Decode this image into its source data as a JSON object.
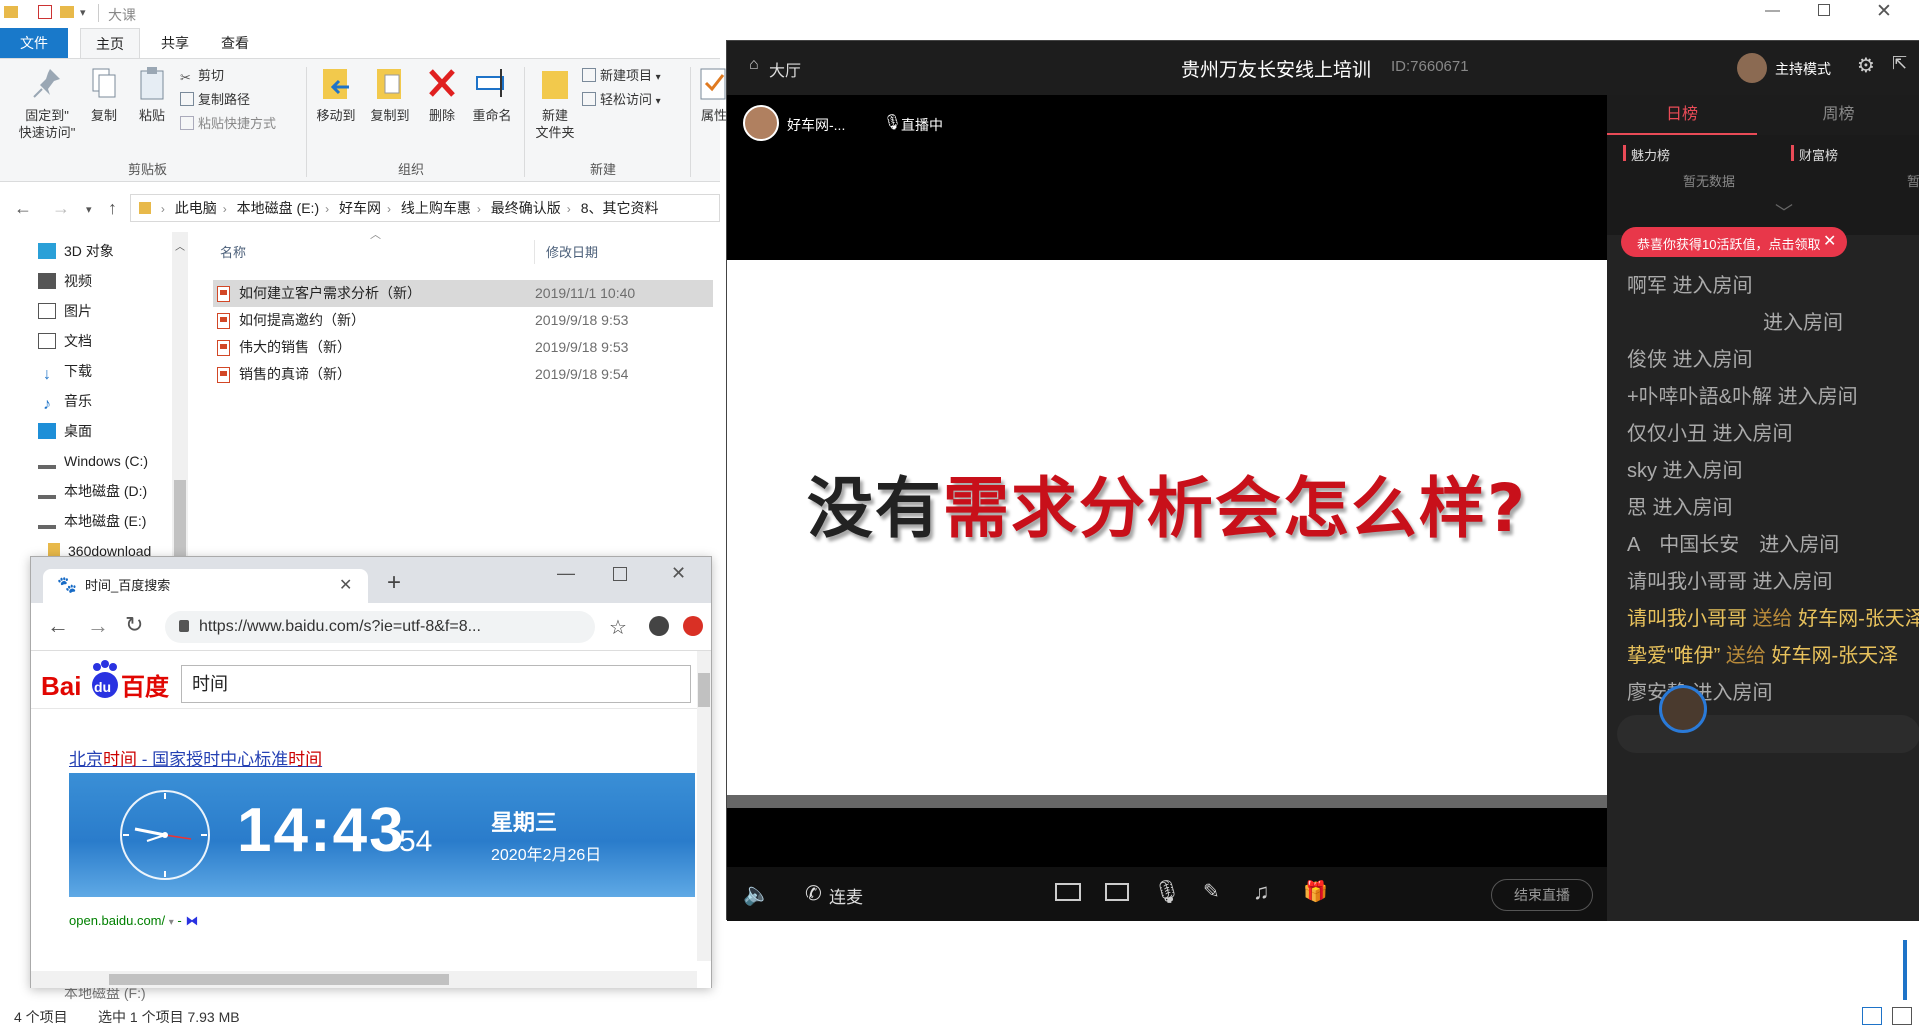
{
  "explorer": {
    "window_title": "大课",
    "tabs": {
      "file": "文件",
      "home": "主页",
      "share": "共享",
      "view": "查看"
    },
    "ribbon": {
      "pin": "固定到\"\n快速访问\"",
      "pin_l1": "固定到\"",
      "pin_l2": "快速访问\"",
      "copy": "复制",
      "paste": "粘贴",
      "cut": "剪切",
      "copy_path": "复制路径",
      "paste_shortcut": "粘贴快捷方式",
      "group_clipboard": "剪贴板",
      "move_to": "移动到",
      "copy_to": "复制到",
      "delete": "删除",
      "rename": "重命名",
      "group_organize": "组织",
      "new_folder_l1": "新建",
      "new_folder_l2": "文件夹",
      "new_item": "新建项目",
      "easy_access": "轻松访问",
      "group_new": "新建",
      "properties": "属性"
    },
    "breadcrumb": [
      "此电脑",
      "本地磁盘 (E:)",
      "好车网",
      "线上购车惠",
      "最终确认版",
      "8、其它资料"
    ],
    "nav": [
      {
        "label": "3D 对象",
        "icon": "3d-objects-icon",
        "color": "#2aa0d8"
      },
      {
        "label": "视频",
        "icon": "video-icon",
        "color": "#555"
      },
      {
        "label": "图片",
        "icon": "pictures-icon",
        "color": "#555"
      },
      {
        "label": "文档",
        "icon": "documents-icon",
        "color": "#555"
      },
      {
        "label": "下载",
        "icon": "download-icon",
        "color": "#1e73c8"
      },
      {
        "label": "音乐",
        "icon": "music-icon",
        "color": "#1e73c8"
      },
      {
        "label": "桌面",
        "icon": "desktop-icon",
        "color": "#1e8fd8"
      },
      {
        "label": "Windows (C:)",
        "icon": "drive-icon",
        "color": "#666"
      },
      {
        "label": "本地磁盘 (D:)",
        "icon": "drive-icon",
        "color": "#666"
      },
      {
        "label": "本地磁盘 (E:)",
        "icon": "drive-icon",
        "color": "#666"
      },
      {
        "label": "360download",
        "icon": "folder-icon",
        "color": "#e8b94a"
      }
    ],
    "nav_bottom": "本地磁盘 (F:)",
    "columns": {
      "name": "名称",
      "date": "修改日期"
    },
    "files": [
      {
        "name": "如何建立客户需求分析（新）",
        "date": "2019/11/1 10:40",
        "selected": true
      },
      {
        "name": "如何提高邀约（新）",
        "date": "2019/9/18 9:53",
        "selected": false
      },
      {
        "name": "伟大的销售（新）",
        "date": "2019/9/18 9:53",
        "selected": false
      },
      {
        "name": "销售的真谛（新）",
        "date": "2019/9/18 9:54",
        "selected": false
      }
    ],
    "status": {
      "count": "4 个项目",
      "selection": "选中 1 个项目  7.93 MB"
    }
  },
  "chrome": {
    "tab_title": "时间_百度搜索",
    "url": "https://www.baidu.com/s?ie=utf-8&f=8...",
    "search_query": "时间",
    "result": {
      "title_pre": "北京",
      "title_hl1": "时间",
      "title_mid": " - 国家授时中心标准",
      "title_hl2": "时间",
      "clock_time": "14:43",
      "clock_sec": "54",
      "weekday": "星期三",
      "date": "2020年2月26日",
      "source": "open.baidu.com/"
    }
  },
  "live": {
    "hall": "大厅",
    "title": "贵州万友长安线上培训",
    "room_id": "ID:7660671",
    "host_mode": "主持模式",
    "streamer_name": "好车网-...",
    "live_status": "直播中",
    "slide_text_black": "没有",
    "slide_text_red": "需求分析会怎么样?",
    "rank_tabs": [
      "日榜",
      "周榜"
    ],
    "charm_rank": "魅力榜",
    "wealth_rank": "财富榜",
    "no_data": "暂无数据",
    "no_data_cut": "暂",
    "reward_banner": "恭喜你获得10活跃值，点击领取",
    "chat": [
      {
        "name": "啊军",
        "msg": " 进入房间"
      },
      {
        "name": "",
        "msg": "进入房间"
      },
      {
        "name": "俊侠",
        "msg": " 进入房间"
      },
      {
        "name": "+卟啈卟語&卟解",
        "msg": " 进入房间"
      },
      {
        "name": "仅仅小丑",
        "msg": " 进入房间"
      },
      {
        "name": "sky",
        "msg": " 进入房间"
      },
      {
        "name": "思",
        "msg": " 进入房间"
      },
      {
        "name": "A　中国长安",
        "msg": "　进入房间"
      },
      {
        "name": "请叫我小哥哥",
        "msg": " 进入房间"
      }
    ],
    "gifts": [
      {
        "name": "请叫我小哥哥",
        "verb": " 送给 ",
        "target": "好车网-张天泽"
      },
      {
        "name": "挚爱“唯伊”",
        "verb": " 送给 ",
        "target": "好车网-张天泽"
      }
    ],
    "last_chat": {
      "name": "廖安静",
      "msg": " 进入房间"
    },
    "bottom": {
      "connect": "连麦",
      "end_live": "结束直播"
    }
  }
}
